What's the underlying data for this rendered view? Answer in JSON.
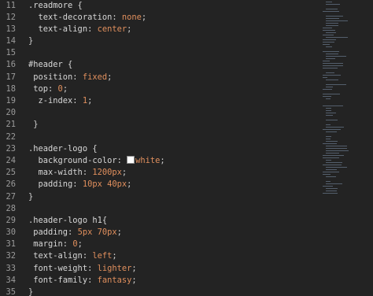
{
  "colors": {
    "background": "#232323",
    "line_number": "#9b9b9b",
    "text": "#d6d6d6",
    "value": "#e08f5d",
    "swatch": "#ffffff"
  },
  "editor": {
    "lines": [
      {
        "number": "11",
        "tokens": [
          {
            "text": ".readmore {",
            "kind": "sel"
          }
        ]
      },
      {
        "number": "12",
        "tokens": [
          {
            "text": "  text-decoration: ",
            "kind": "prop"
          },
          {
            "text": "none",
            "kind": "val"
          },
          {
            "text": ";",
            "kind": "punct"
          }
        ]
      },
      {
        "number": "13",
        "tokens": [
          {
            "text": "  text-align: ",
            "kind": "prop"
          },
          {
            "text": "center",
            "kind": "val"
          },
          {
            "text": ";",
            "kind": "punct"
          }
        ]
      },
      {
        "number": "14",
        "tokens": [
          {
            "text": "}",
            "kind": "punct"
          }
        ]
      },
      {
        "number": "15",
        "tokens": []
      },
      {
        "number": "16",
        "tokens": [
          {
            "text": "#header {",
            "kind": "sel"
          }
        ]
      },
      {
        "number": "17",
        "tokens": [
          {
            "text": " position: ",
            "kind": "prop"
          },
          {
            "text": "fixed",
            "kind": "val"
          },
          {
            "text": ";",
            "kind": "punct"
          }
        ]
      },
      {
        "number": "18",
        "tokens": [
          {
            "text": " top: ",
            "kind": "prop"
          },
          {
            "text": "0",
            "kind": "val"
          },
          {
            "text": ";",
            "kind": "punct"
          }
        ]
      },
      {
        "number": "19",
        "tokens": [
          {
            "text": "  z-index: ",
            "kind": "prop"
          },
          {
            "text": "1",
            "kind": "val"
          },
          {
            "text": ";",
            "kind": "punct"
          }
        ]
      },
      {
        "number": "20",
        "tokens": []
      },
      {
        "number": "21",
        "tokens": [
          {
            "text": " }",
            "kind": "punct"
          }
        ]
      },
      {
        "number": "22",
        "tokens": []
      },
      {
        "number": "23",
        "tokens": [
          {
            "text": ".header-logo {",
            "kind": "sel"
          }
        ]
      },
      {
        "number": "24",
        "tokens": [
          {
            "text": "  background-color: ",
            "kind": "prop"
          },
          {
            "text": "",
            "kind": "swatch"
          },
          {
            "text": "white",
            "kind": "val"
          },
          {
            "text": ";",
            "kind": "punct"
          }
        ]
      },
      {
        "number": "25",
        "tokens": [
          {
            "text": "  max-width: ",
            "kind": "prop"
          },
          {
            "text": "1200px",
            "kind": "val"
          },
          {
            "text": ";",
            "kind": "punct"
          }
        ]
      },
      {
        "number": "26",
        "tokens": [
          {
            "text": "  padding: ",
            "kind": "prop"
          },
          {
            "text": "10px 40px",
            "kind": "val"
          },
          {
            "text": ";",
            "kind": "punct"
          }
        ]
      },
      {
        "number": "27",
        "tokens": [
          {
            "text": "}",
            "kind": "punct"
          }
        ]
      },
      {
        "number": "28",
        "tokens": []
      },
      {
        "number": "29",
        "tokens": [
          {
            "text": ".header-logo h1{",
            "kind": "sel"
          }
        ]
      },
      {
        "number": "30",
        "tokens": [
          {
            "text": " padding: ",
            "kind": "prop"
          },
          {
            "text": "5px 70px",
            "kind": "val"
          },
          {
            "text": ";",
            "kind": "punct"
          }
        ]
      },
      {
        "number": "31",
        "tokens": [
          {
            "text": " margin: ",
            "kind": "prop"
          },
          {
            "text": "0",
            "kind": "val"
          },
          {
            "text": ";",
            "kind": "punct"
          }
        ]
      },
      {
        "number": "32",
        "tokens": [
          {
            "text": " text-align: ",
            "kind": "prop"
          },
          {
            "text": "left",
            "kind": "val"
          },
          {
            "text": ";",
            "kind": "punct"
          }
        ]
      },
      {
        "number": "33",
        "tokens": [
          {
            "text": " font-weight: ",
            "kind": "prop"
          },
          {
            "text": "lighter",
            "kind": "val"
          },
          {
            "text": ";",
            "kind": "punct"
          }
        ]
      },
      {
        "number": "34",
        "tokens": [
          {
            "text": " font-family: ",
            "kind": "prop"
          },
          {
            "text": "fantasy",
            "kind": "val"
          },
          {
            "text": ";",
            "kind": "punct"
          }
        ]
      },
      {
        "number": "35",
        "tokens": [
          {
            "text": "}",
            "kind": "punct"
          }
        ]
      }
    ]
  }
}
